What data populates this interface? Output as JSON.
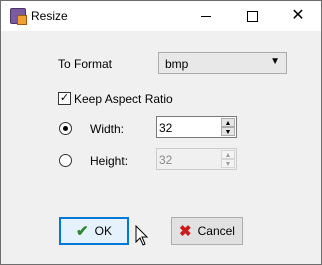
{
  "window": {
    "title": "Resize"
  },
  "format": {
    "label": "To Format",
    "value": "bmp"
  },
  "aspect": {
    "label": "Keep Aspect Ratio",
    "checked": true
  },
  "width": {
    "label": "Width:",
    "value": "32",
    "selected": true
  },
  "height": {
    "label": "Height:",
    "value": "32",
    "enabled": false
  },
  "buttons": {
    "ok": "OK",
    "cancel": "Cancel"
  },
  "icons": {
    "ok": "check-icon",
    "cancel": "x-icon",
    "format_dropdown": "chevron-down-icon"
  }
}
